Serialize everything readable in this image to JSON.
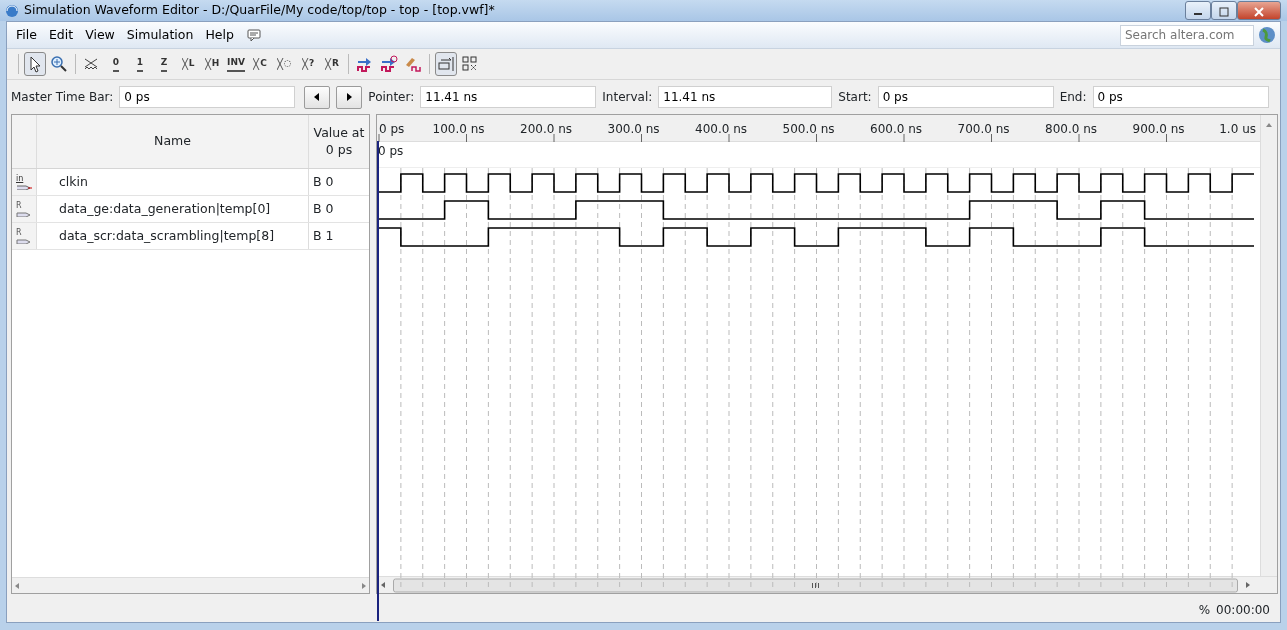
{
  "window": {
    "title": "Simulation Waveform Editor - D:/QuarFile/My code/top/top - top - [top.vwf]*"
  },
  "menu": [
    "File",
    "Edit",
    "View",
    "Simulation",
    "Help"
  ],
  "search": {
    "placeholder": "Search altera.com"
  },
  "toolbar": [
    {
      "kind": "pointer",
      "selected": true
    },
    {
      "kind": "zoom",
      "selected": false
    },
    {
      "kind": "sep"
    },
    {
      "kind": "unknown"
    },
    {
      "kind": "level",
      "glyph": "0"
    },
    {
      "kind": "level",
      "glyph": "1"
    },
    {
      "kind": "level",
      "glyph": "Z"
    },
    {
      "kind": "bus",
      "glyph": "L"
    },
    {
      "kind": "bus",
      "glyph": "H"
    },
    {
      "kind": "level",
      "glyph": "INV"
    },
    {
      "kind": "bus",
      "glyph": "C"
    },
    {
      "kind": "bus",
      "glyph": "◌"
    },
    {
      "kind": "bus",
      "glyph": "?"
    },
    {
      "kind": "bus",
      "glyph": "R"
    },
    {
      "kind": "sep"
    },
    {
      "kind": "run"
    },
    {
      "kind": "run-timing"
    },
    {
      "kind": "edit"
    },
    {
      "kind": "sep"
    },
    {
      "kind": "snap",
      "selected": true
    },
    {
      "kind": "grid",
      "selected": false
    }
  ],
  "timebar": [
    {
      "label": "Master Time Bar:",
      "value": "0 ps"
    },
    {
      "label": "Pointer:",
      "value": "11.41 ns"
    },
    {
      "label": "Interval:",
      "value": "11.41 ns"
    },
    {
      "label": "Start:",
      "value": "0 ps"
    },
    {
      "label": "End:",
      "value": "0 ps"
    }
  ],
  "table": {
    "columns": [
      "Name",
      "Value at\n0 ps"
    ],
    "rows": [
      {
        "icon_text": "in",
        "kind": "input",
        "name": "clkin",
        "value": "B 0"
      },
      {
        "icon_text": "R",
        "kind": "register",
        "name": "data_ge:data_generation|temp[0]",
        "value": "B 0"
      },
      {
        "icon_text": "R",
        "kind": "register",
        "name": "data_scr:data_scrambling|temp[8]",
        "value": "B 1"
      }
    ]
  },
  "ruler": {
    "labels": [
      "0 ps",
      "100.0 ns",
      "200.0 ns",
      "300.0 ns",
      "400.0 ns",
      "500.0 ns",
      "600.0 ns",
      "700.0 ns",
      "800.0 ns",
      "900.0 ns",
      "1.0 us"
    ],
    "cursor": "0 ps"
  },
  "status_bar": {
    "percent": "%",
    "time": "00:00:00"
  }
}
